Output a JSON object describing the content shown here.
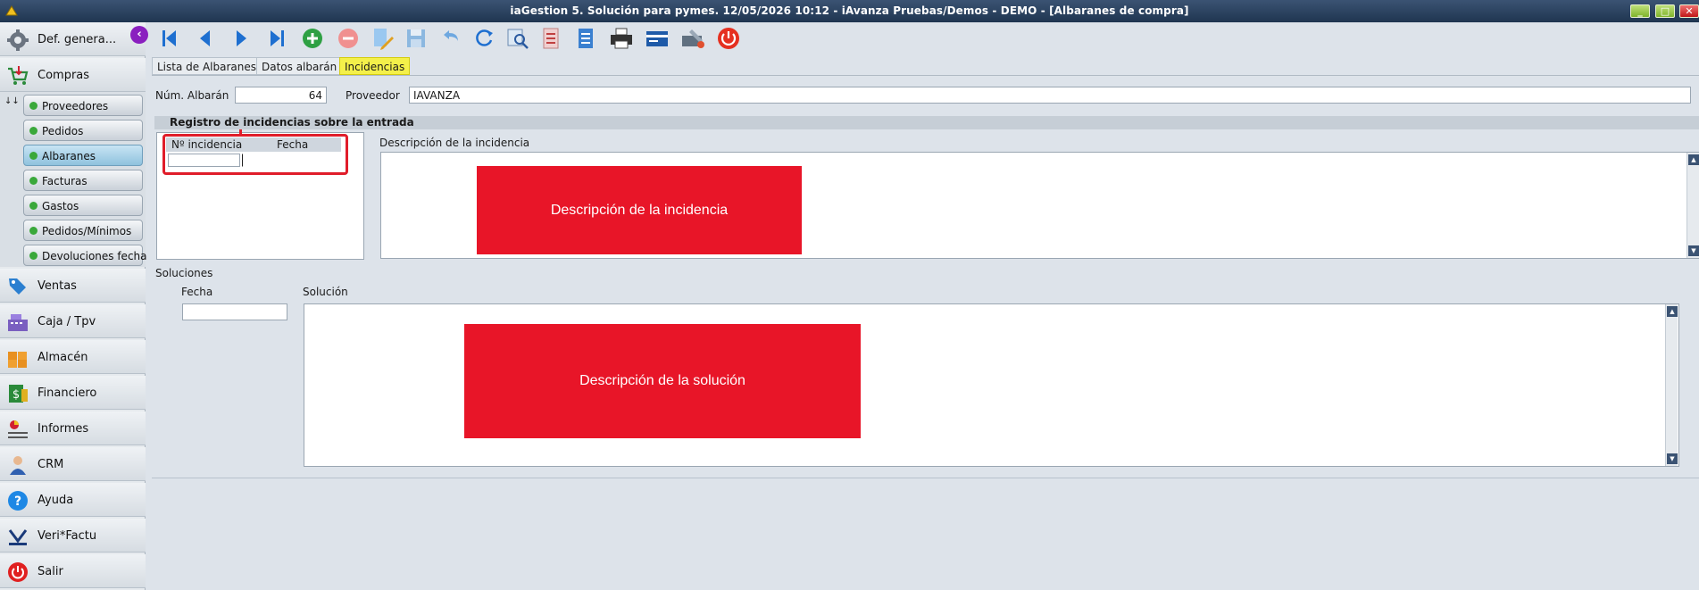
{
  "window": {
    "title": "iaGestion 5. Solución para pymes.   12/05/2026 10:12   -   iAvanza Pruebas/Demos - DEMO - [Albaranes de compra]"
  },
  "sidebar": {
    "header": {
      "label": "Def. genera...",
      "icon": "gear-icon"
    },
    "section": {
      "label": "Compras",
      "icon": "cart-icon"
    },
    "subitems": [
      {
        "label": "Proveedores"
      },
      {
        "label": "Pedidos"
      },
      {
        "label": "Albaranes",
        "active": true
      },
      {
        "label": "Facturas"
      },
      {
        "label": "Gastos"
      },
      {
        "label": "Pedidos/Mínimos"
      },
      {
        "label": "Devoluciones fecha"
      }
    ],
    "items": [
      {
        "label": "Ventas",
        "icon": "sales-icon"
      },
      {
        "label": "Caja / Tpv",
        "icon": "cash-register-icon"
      },
      {
        "label": "Almacén",
        "icon": "warehouse-icon"
      },
      {
        "label": "Financiero",
        "icon": "money-icon"
      },
      {
        "label": "Informes",
        "icon": "report-icon"
      },
      {
        "label": "CRM",
        "icon": "person-icon"
      },
      {
        "label": "Ayuda",
        "icon": "help-icon"
      },
      {
        "label": "Veri*Factu",
        "icon": "verifactu-icon"
      },
      {
        "label": "Salir",
        "icon": "power-icon"
      }
    ]
  },
  "toolbar": {
    "icons": [
      "first-icon",
      "previous-icon",
      "next-icon",
      "last-icon",
      "add-icon",
      "delete-icon",
      "edit-icon",
      "save-icon",
      "undo-icon",
      "refresh-icon",
      "search-icon",
      "report-icon",
      "document-icon",
      "print-icon",
      "card-icon",
      "tools-icon",
      "exit-icon"
    ]
  },
  "tabs": [
    {
      "label": "Lista de Albaranes"
    },
    {
      "label": "Datos albarán"
    },
    {
      "label": "Incidencias",
      "active": true
    }
  ],
  "form": {
    "num_albaran_label": "Núm. Albarán",
    "num_albaran_value": "64",
    "proveedor_label": "Proveedor",
    "proveedor_value": "IAVANZA",
    "section_title": "Registro de incidencias sobre la entrada",
    "grid_col_num": "Nº incidencia",
    "grid_col_fecha": "Fecha",
    "descripcion_label": "Descripción de la incidencia",
    "descripcion_placeholder": "Descripción de la incidencia",
    "soluciones_label": "Soluciones",
    "sol_fecha_label": "Fecha",
    "solucion_label": "Solución",
    "solucion_placeholder": "Descripción de la solución"
  },
  "colors": {
    "accent_red": "#e81528",
    "active_tab": "#f4f04a",
    "title_bar": "#2b4260"
  }
}
